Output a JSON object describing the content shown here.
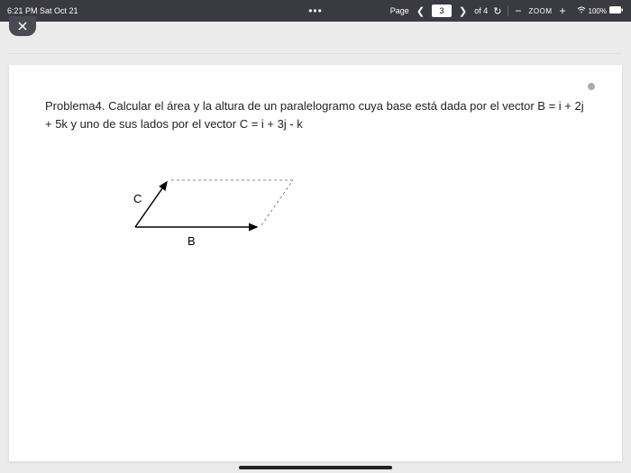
{
  "status": {
    "time_date": "6:21 PM  Sat Oct 21",
    "battery_pct": "100%"
  },
  "toolbar": {
    "page_label": "Page",
    "current_page": "3",
    "of_label": "of 4",
    "zoom_label": "ZOOM"
  },
  "document": {
    "problem_text": "Problema4. Calcular el área y la  altura de un paralelogramo cuya base está dada por el vector B = i  + 2j   + 5k   y uno de sus lados por el vector C = i  + 3j  - k",
    "label_c": "C",
    "label_b": "B"
  }
}
